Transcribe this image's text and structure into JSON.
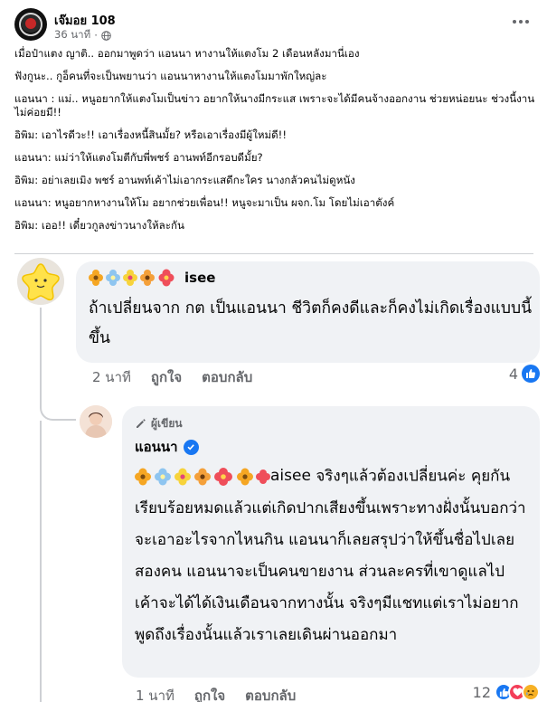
{
  "post": {
    "page_name": "เจ๊มอย 108",
    "time": "36 นาที",
    "separator": "·",
    "body_lines": [
      "เมื่อป๋าแตง ญาติ.. ออกมาพูดว่า แอนนา หางานให้แตงโม 2 เดือนหลังมานี่เอง",
      "ฟังกูนะ.. กูอ็คนที่จะเป็นพยานว่า แอนนาหางานให้แตงโมมาพักใหญ่ละ",
      "แอนนา : แม่.. หนูอยากให้แตงโมเป็นข่าว อยากให้นางมีกระแส เพราะจะได้มีคนจ้างออกงาน ช่วยหน่อยนะ ช่วงนี้งานไม่ค่อยมี!!",
      "อิพิม: เอาไรดีวะ!! เอาเรื่องหนี้สินมั้ย? หรือเอาเรื่องมีผู้ใหม่ดี!!",
      "แอนนา: แม่ว่าให้แตงโมตีกับพี่พชร์ อานพท์อีกรอบดีมั้ย?",
      "อิพิม: อย่าเลยเมิง พชร์ อานพท์เค้าไม่เอากระแสดีกะใคร นางกลัวคนไม่ดูหนัง",
      "แอนนา: หนูอยากหางานให้โม อยากช่วยเพื่อน!! หนูจะมาเป็น ผจก.โม โดยไม่เอาตังค์",
      "อิพิม: เออ!! เดี๋ยวกูลงข่าวนางให้ละกัน"
    ]
  },
  "comments": [
    {
      "name_suffix": "isee",
      "text": "ถ้าเปลี่ยนจาก กต เป็นแอนนา ชีวิตก็คงดีและก็คงไม่เกิดเรื่องแบบนี้ขึ้น",
      "time": "2 นาที",
      "like_label": "ถูกใจ",
      "reply_label": "ตอบกลับ",
      "reaction_count": "4",
      "reaction_icons": [
        "like-icon"
      ]
    },
    {
      "badge": "ผู้เขียน",
      "author": "แอนนา",
      "mention_suffix": "aisee",
      "text": " จริงๆแล้วต้องเปลี่ยนค่ะ คุยกันเรียบร้อยหมดแล้วแต่เกิดปากเสียงขึ้นเพราะทางฝั่งนั้นบอกว่าจะเอาอะไรจากไหนกิน แอนนาก็เลยสรุปว่าให้ขึ้นชื่อไปเลยสองคน แอนนาจะเป็นคนขายงาน ส่วนละครที่เขาดูแลไป เค้าจะได้ได้เงินเดือนจากทางนั้น จริงๆมีแชทแต่เราไม่อยากพูดถึงเรื่องนั้นแล้วเราเลยเดินผ่านออกมา",
      "time": "1 นาที",
      "like_label": "ถูกใจ",
      "reply_label": "ตอบกลับ",
      "reaction_count": "12",
      "reaction_icons": [
        "like-icon",
        "love-icon",
        "sad-icon"
      ]
    }
  ],
  "colors": {
    "accent": "#1877f2",
    "bubble": "#f0f2f5",
    "secondary_text": "#65676b",
    "love": "#f33e58",
    "sad": "#f7b125"
  }
}
